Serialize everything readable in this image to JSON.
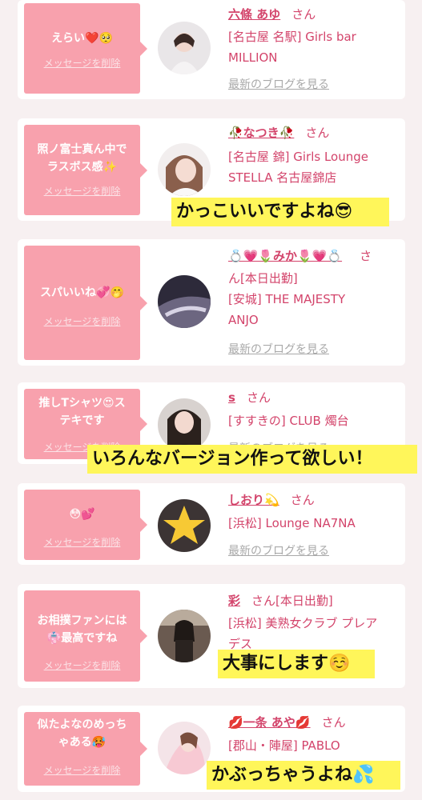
{
  "captions": {
    "c1": "かっこいいですよね😎",
    "c2": "いろんなバージョン作って欲しい！",
    "c3": "大事にします☺️",
    "c4": "かぶっちゃうよね💦"
  },
  "cards": [
    {
      "message_lines": [
        "えらい❤️🥺"
      ],
      "delete_label": "メッセージを削除",
      "name": "六條 あゆ",
      "honorific": "さん",
      "shop_lines": [
        "[名古屋 名駅] Girls bar",
        "MILLION"
      ],
      "blog_label": "最新のブログを見る"
    },
    {
      "message_lines": [
        "照ノ富士真ん中で",
        "ラスボス感✨"
      ],
      "delete_label": "メッセージを削除",
      "name": "🥀なつき🥀",
      "honorific": "さん",
      "shop_lines": [
        "[名古屋 錦] Girls Lounge",
        "STELLA 名古屋錦店"
      ],
      "blog_label": ""
    },
    {
      "message_lines": [
        "スパいいね💞🤭"
      ],
      "delete_label": "メッセージを削除",
      "name": "💍💗🌷みか🌷💗💍",
      "honorific": "さ",
      "honorific_rest": "ん",
      "status": "[本日出勤]",
      "shop_lines": [
        "[安城] THE MAJESTY",
        "ANJO"
      ],
      "blog_label": "最新のブログを見る"
    },
    {
      "message_lines": [
        "推しTシャツ😍ス",
        "テキです"
      ],
      "delete_label": "メッセージを削除",
      "name": "s",
      "honorific": "さん",
      "shop_lines": [
        "[すすきの] CLUB 燭台"
      ],
      "blog_label": "最新のブログを見る"
    },
    {
      "message_lines": [
        "😳💕"
      ],
      "delete_label": "メッセージを削除",
      "name": "しおり💫",
      "honorific": "さん",
      "shop_lines": [
        "[浜松] Lounge NA7NA"
      ],
      "blog_label": "最新のブログを見る"
    },
    {
      "message_lines": [
        "お相撲ファンには",
        "👘最高ですね"
      ],
      "delete_label": "メッセージを削除",
      "name": "彩",
      "honorific": "さん",
      "status": "[本日出勤]",
      "shop_lines": [
        "[浜松] 美熟女クラブ プレア",
        "デス"
      ],
      "blog_label": ""
    },
    {
      "message_lines": [
        "似たよなのめっち",
        "ゃある🥵"
      ],
      "delete_label": "メッセージを削除",
      "name": "💋一条 あや💋",
      "honorific": "さん",
      "shop_lines": [
        "[郡山・陣屋] PABLO"
      ],
      "blog_label": ""
    }
  ],
  "colors": {
    "bubble": "#f8a1ad",
    "accent_text": "#d3446b",
    "muted_link": "#a9a9a9",
    "caption_bg": "#fff65a"
  }
}
